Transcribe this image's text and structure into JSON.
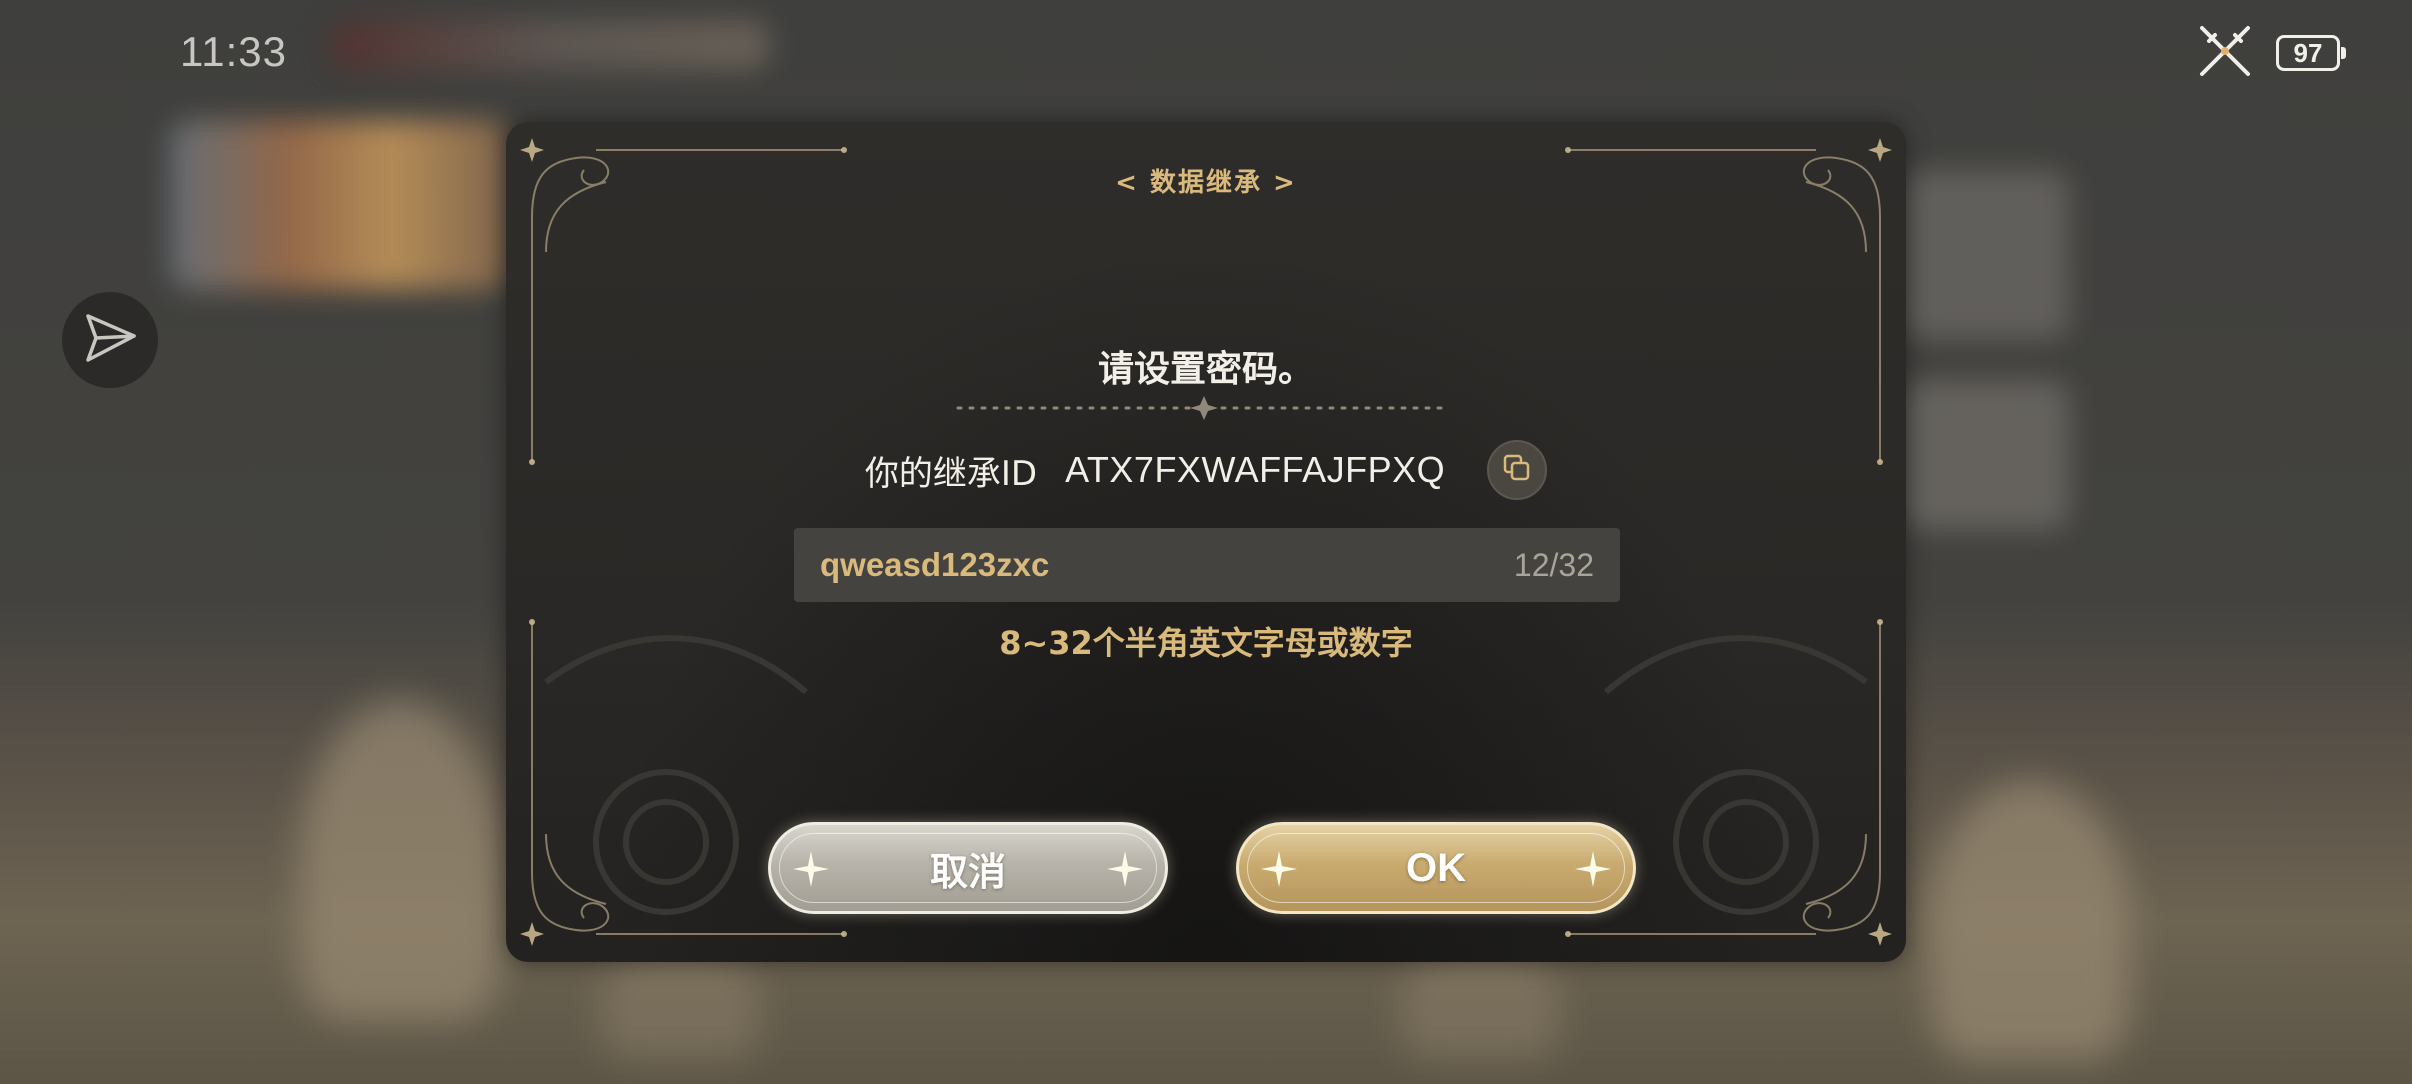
{
  "status_bar": {
    "time": "11:33",
    "battery_level": "97",
    "icon": "crossed-swords-icon"
  },
  "side": {
    "share_icon": "send-icon"
  },
  "dialog": {
    "title": "< 数据继承 >",
    "heading": "请设置密码。",
    "id_label": "你的继承ID",
    "id_value": "ATX7FXWAFFAJFPXQ",
    "copy_icon": "copy-icon",
    "password_value": "qweasd123zxc",
    "password_counter": "12/32",
    "hint": "8~32个半角英文字母或数字",
    "cancel_label": "取消",
    "ok_label": "OK"
  },
  "colors": {
    "accent_gold": "#d9b97c",
    "dialog_bg": "#2a2826",
    "text_light": "#f2efe8"
  }
}
